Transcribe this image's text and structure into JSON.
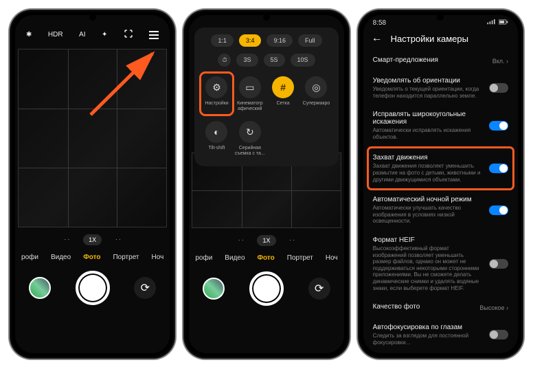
{
  "phone1": {
    "topbar": {
      "flash": "✱",
      "hdr": "HDR",
      "ai": "AI",
      "sparkle": "✦",
      "frame": "",
      "menu": ""
    },
    "zoom": {
      "dots_left": ". .",
      "value": "1X",
      "dots_right": ". ."
    },
    "modes": [
      "рофи",
      "Видео",
      "Фото",
      "Портрет",
      "Ноч"
    ],
    "mode_active_index": 2
  },
  "phone2": {
    "aspect": [
      "1:1",
      "3:4",
      "9:16",
      "Full"
    ],
    "aspect_active_index": 1,
    "timer": [
      "⏱",
      "3S",
      "5S",
      "10S"
    ],
    "qs": [
      {
        "label": "Настройки",
        "icon": "⚙",
        "hi": true
      },
      {
        "label": "Кинематогр афический",
        "icon": "▭"
      },
      {
        "label": "Сетка",
        "icon": "#",
        "on": true
      },
      {
        "label": "Супермакро",
        "icon": "◎"
      },
      {
        "label": "Tilt-shift",
        "icon": "◐"
      },
      {
        "label": "Серийная съемка с та...",
        "icon": "↻"
      }
    ],
    "zoom": {
      "dots_left": ". .",
      "value": "1X",
      "dots_right": ". ."
    },
    "modes": [
      "рофи",
      "Видео",
      "Фото",
      "Портрет",
      "Ноч"
    ],
    "mode_active_index": 2
  },
  "phone3": {
    "time": "8:58",
    "title": "Настройки камеры",
    "rows": [
      {
        "kind": "link",
        "title": "Смарт-предложения",
        "value": "Вкл. ›"
      },
      {
        "kind": "toggle",
        "title": "Уведомлять об ориентации",
        "desc": "Уведомлять о текущей ориентации, когда телефон находится параллельно земле.",
        "on": false
      },
      {
        "kind": "toggle",
        "title": "Исправлять широкоугольные искажения",
        "desc": "Автоматически исправлять искажения объектов.",
        "on": true
      },
      {
        "kind": "toggle",
        "title": "Захват движения",
        "desc": "Захват движения позволяет уменьшить размытие на фото с детьми, животными и другими движущимися объектами.",
        "on": true,
        "hi": true
      },
      {
        "kind": "toggle",
        "title": "Автоматический ночной режим",
        "desc": "Автоматически улучшать качество изображения в условиях низкой освещенности.",
        "on": true
      },
      {
        "kind": "toggle",
        "title": "Формат HEIF",
        "desc": "Высокоэффективный формат изображений позволяет уменьшить размер файлов, однако он может не поддерживаться некоторыми сторонними приложениями. Вы не сможете делать динамические снимки и удалять водяные знаки, если выберете формат HEIF.",
        "on": false
      },
      {
        "kind": "link",
        "title": "Качество фото",
        "value": "Высокое ›"
      },
      {
        "kind": "toggle",
        "title": "Автофокусировка по глазам",
        "desc": "Следить за взглядом для постоянной фокусировки...",
        "on": false
      }
    ]
  }
}
